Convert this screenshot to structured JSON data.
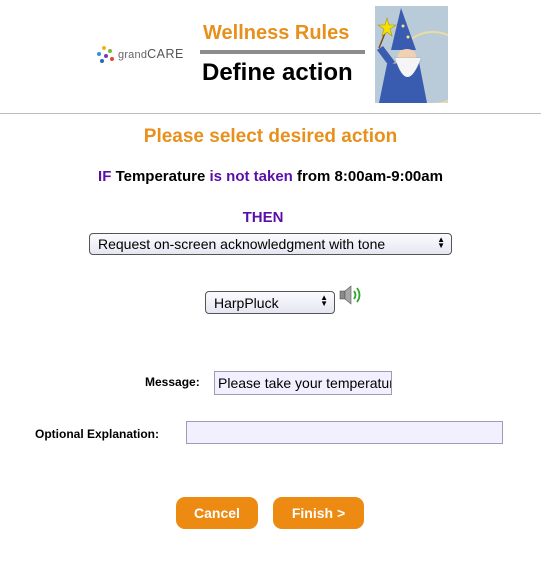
{
  "header": {
    "logo": {
      "small": "grand",
      "caps": "CARE"
    },
    "title": "Wellness Rules",
    "subtitle": "Define action"
  },
  "colors": {
    "accent_orange": "#e8901c",
    "purple": "#5b0fa8",
    "button_orange": "#ed8a12"
  },
  "main": {
    "heading": "Please select desired action",
    "rule": {
      "if_label": "IF",
      "item": "Temperature",
      "condition": "is not taken",
      "from_label": "from",
      "time_range": "8:00am-9:00am"
    },
    "then_label": "THEN",
    "action_select": {
      "selected": "Request on-screen acknowledgment with tone"
    },
    "sound_select": {
      "selected": "HarpPluck"
    },
    "speaker_icon": "speaker-icon",
    "message": {
      "label": "Message:",
      "value": "Please take your temperature"
    },
    "explanation": {
      "label": "Optional Explanation:",
      "value": ""
    }
  },
  "buttons": {
    "cancel": "Cancel",
    "finish": "Finish >"
  }
}
